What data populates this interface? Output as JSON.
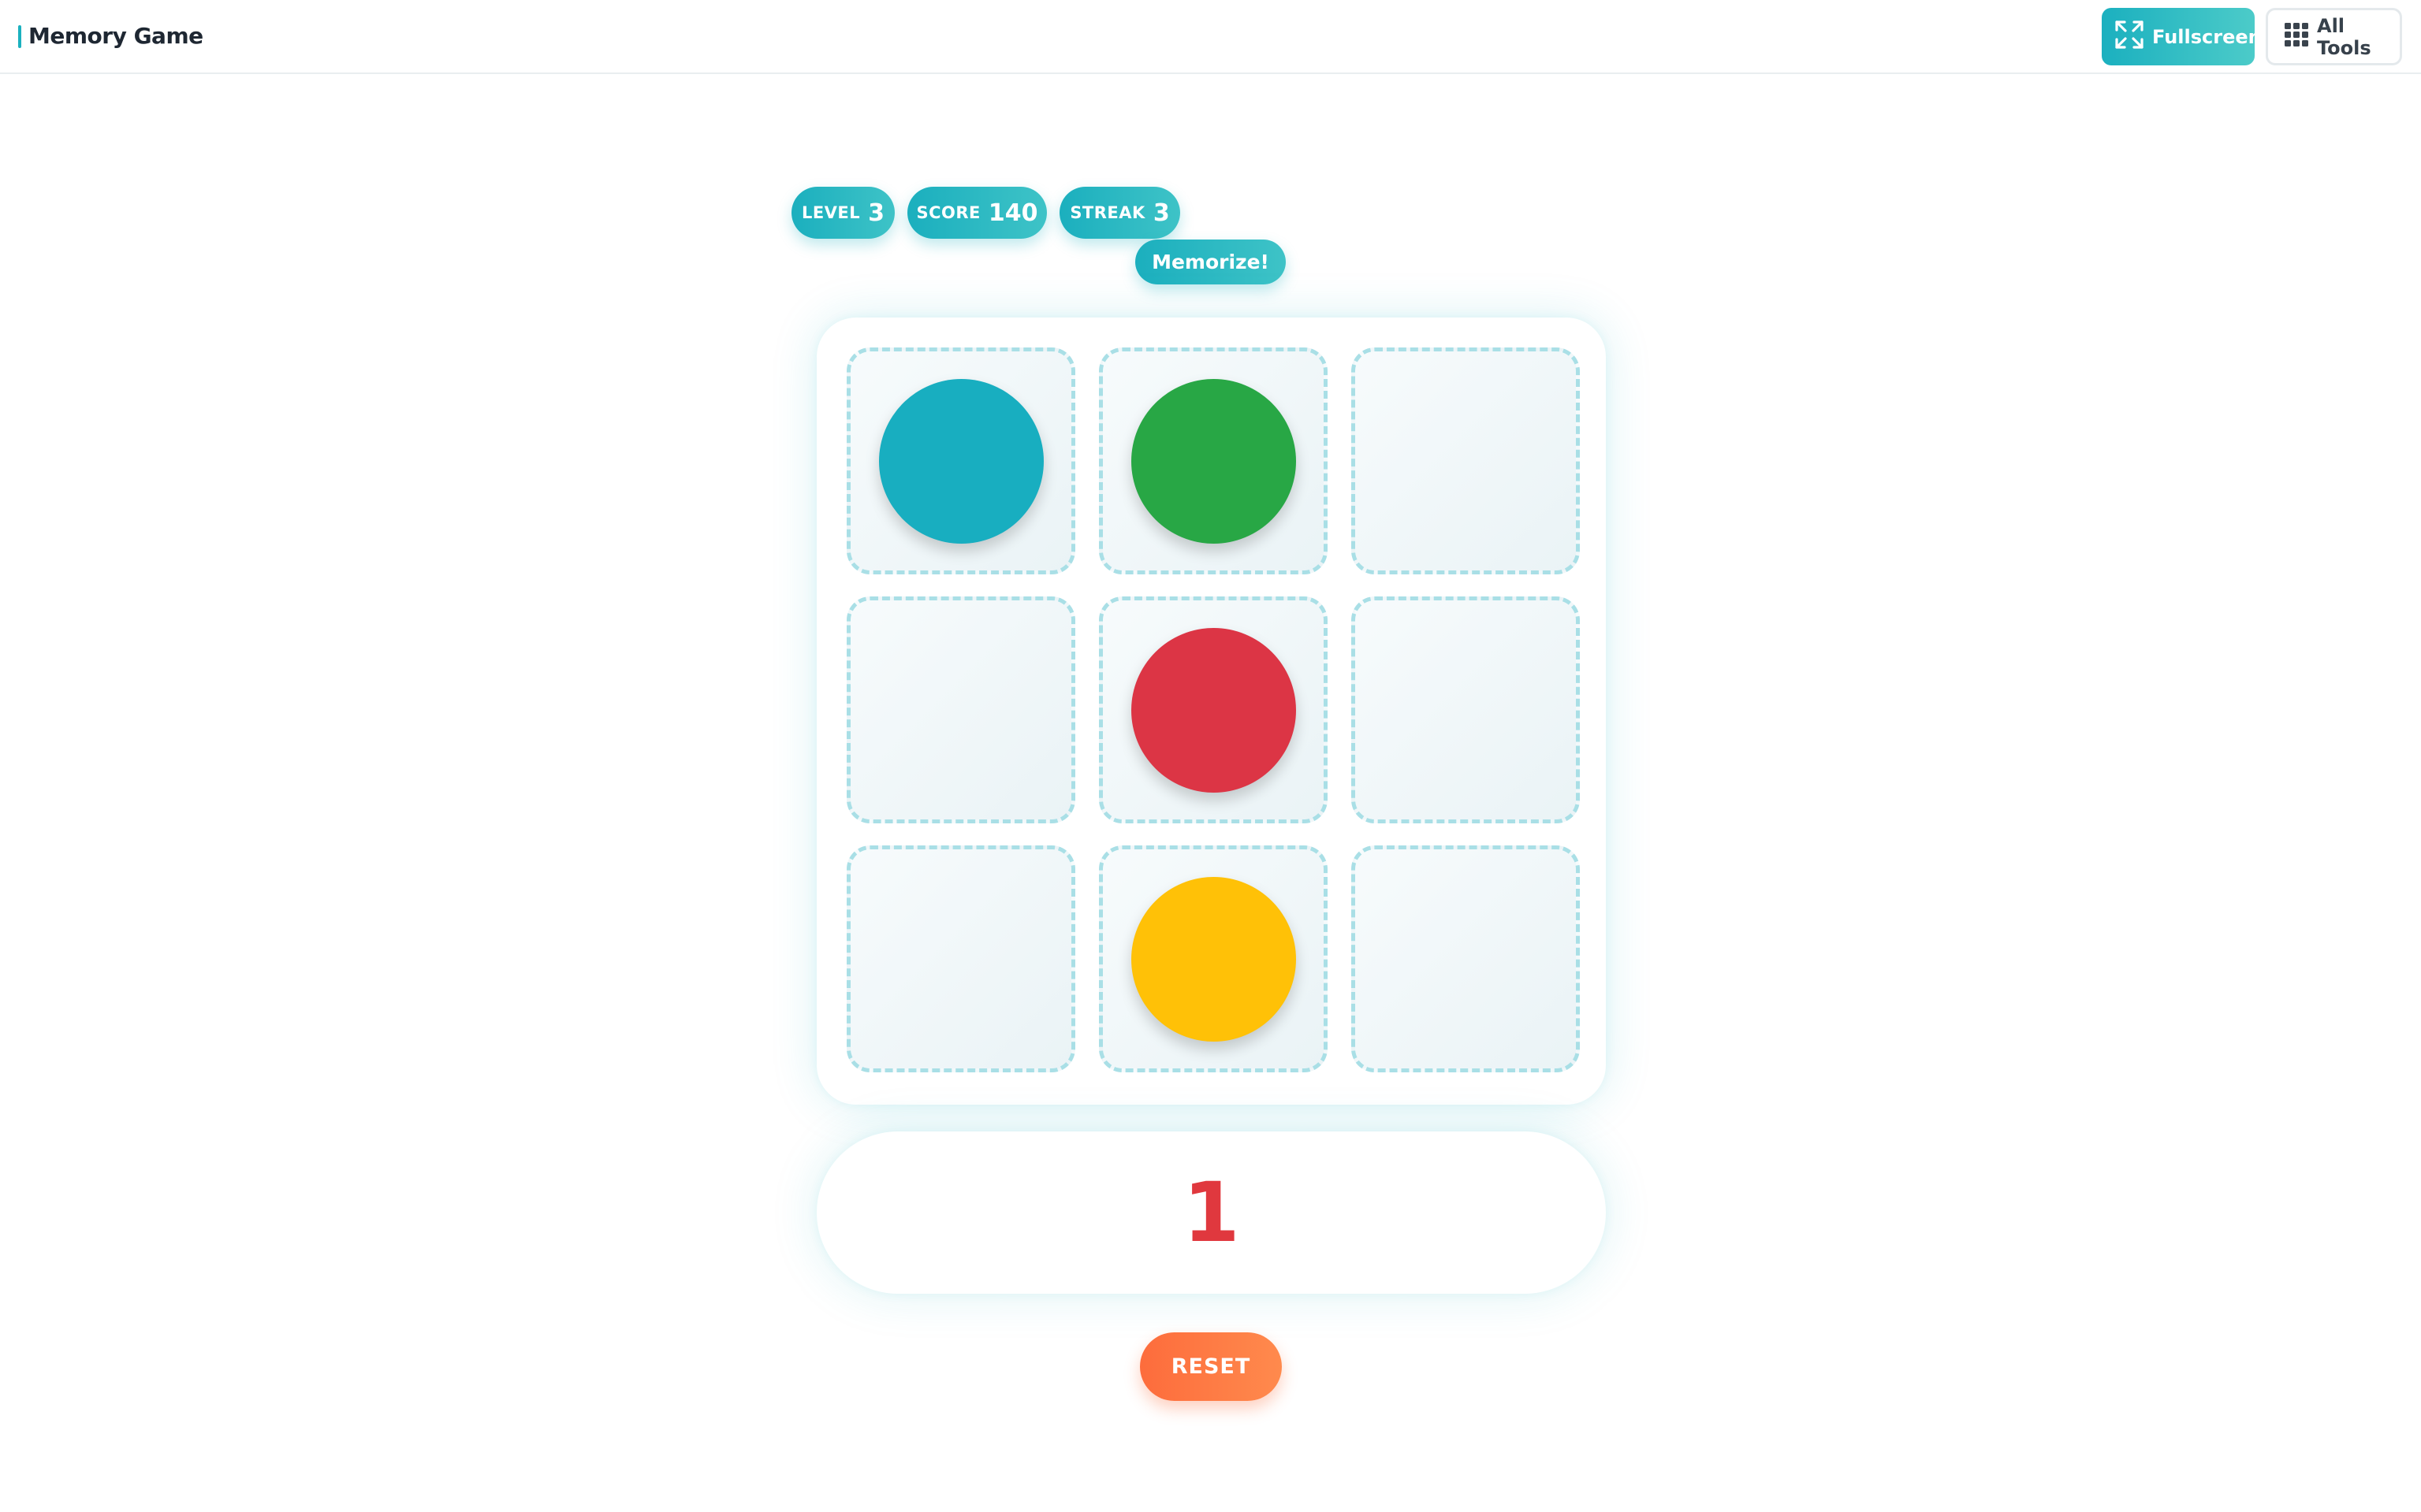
{
  "header": {
    "title": "Memory Game",
    "fullscreen_label": "Fullscreen",
    "all_tools_label": "All Tools",
    "fullscreen_icon": "expand-icon",
    "all_tools_icon": "grid-icon",
    "accent_color": "#1bb1bf"
  },
  "stats": {
    "level_label": "LEVEL",
    "level_value": "3",
    "score_label": "SCORE",
    "score_value": "140",
    "streak_label": "STREAK",
    "streak_value": "3"
  },
  "status": {
    "message": "Memorize!"
  },
  "board": {
    "rows": 3,
    "cols": 3,
    "cells": [
      {
        "row": 1,
        "col": 1,
        "color": "#18aec0"
      },
      {
        "row": 1,
        "col": 2,
        "color": "#28a745"
      },
      {
        "row": 1,
        "col": 3,
        "color": null
      },
      {
        "row": 2,
        "col": 1,
        "color": null
      },
      {
        "row": 2,
        "col": 2,
        "color": "#dc3545"
      },
      {
        "row": 2,
        "col": 3,
        "color": null
      },
      {
        "row": 3,
        "col": 1,
        "color": null
      },
      {
        "row": 3,
        "col": 2,
        "color": "#ffc107"
      },
      {
        "row": 3,
        "col": 3,
        "color": null
      }
    ]
  },
  "countdown": {
    "value": "1",
    "color": "#e0383e"
  },
  "controls": {
    "reset_label": "RESET",
    "reset_color": "#fd6c3c"
  }
}
